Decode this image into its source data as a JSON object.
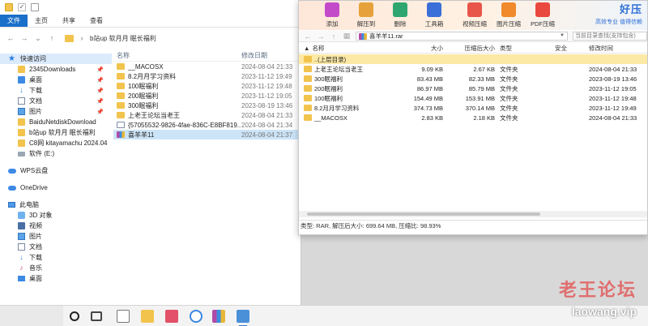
{
  "explorer": {
    "ribbon_tabs": [
      "文件",
      "主页",
      "共享",
      "查看"
    ],
    "address": "b站up 软月月 眠长福利",
    "sidebar": {
      "quick_access_label": "快速访问",
      "pinned": [
        {
          "label": "2345Downloads",
          "icon": "folder-icon"
        },
        {
          "label": "桌面",
          "icon": "desktop-icon"
        },
        {
          "label": "下载",
          "icon": "download-icon"
        },
        {
          "label": "文档",
          "icon": "document-icon"
        },
        {
          "label": "图片",
          "icon": "picture-icon"
        }
      ],
      "recent": [
        {
          "label": "BaiduNetdiskDownload",
          "icon": "folder-icon"
        },
        {
          "label": "b站up 软月月 眠长福利",
          "icon": "folder-icon"
        },
        {
          "label": "C8网 kitayamachu 2024.04",
          "icon": "folder-icon"
        },
        {
          "label": "软件 (E:)",
          "icon": "drive-icon"
        }
      ],
      "wps_label": "WPS云盘",
      "onedrive_label": "OneDrive",
      "this_pc_label": "此电脑",
      "pc_items": [
        {
          "label": "3D 对象",
          "icon": "3d-objects-icon"
        },
        {
          "label": "视频",
          "icon": "video-icon"
        },
        {
          "label": "图片",
          "icon": "picture-icon"
        },
        {
          "label": "文档",
          "icon": "document-icon"
        },
        {
          "label": "下载",
          "icon": "download-icon"
        },
        {
          "label": "音乐",
          "icon": "music-icon"
        },
        {
          "label": "桌面",
          "icon": "desktop-icon"
        }
      ]
    },
    "columns": {
      "name": "名称",
      "date": "修改日期"
    },
    "files": [
      {
        "name": "__MACOSX",
        "date": "2024-08-04 21:33",
        "kind": "folder"
      },
      {
        "name": "8.2月月学习资料",
        "date": "2023-11-12 19:49",
        "kind": "folder"
      },
      {
        "name": "100眠福利",
        "date": "2023-11-12 19:48",
        "kind": "folder"
      },
      {
        "name": "200眠福利",
        "date": "2023-11-12 19:05",
        "kind": "folder"
      },
      {
        "name": "300眠福利",
        "date": "2023-08-19 13:46",
        "kind": "folder"
      },
      {
        "name": "上老王论坛当老王",
        "date": "2024-08-04 21:33",
        "kind": "folder"
      },
      {
        "name": "{57055532-9826-4fae-836C-E8BF819...",
        "date": "2024-08-04 21:34",
        "kind": "doc"
      },
      {
        "name": "喜羊羊11",
        "date": "2024-08-04 21:37",
        "kind": "rar"
      }
    ]
  },
  "winrar": {
    "toolbar": [
      {
        "label": "添加",
        "color": "#c34bc9"
      },
      {
        "label": "解压到",
        "color": "#e6a13a"
      },
      {
        "label": "删除",
        "color": "#2fa66f"
      },
      {
        "label": "工具箱",
        "color": "#3a6ed8"
      },
      {
        "label": "视频压缩",
        "color": "#e8564a"
      },
      {
        "label": "图片压缩",
        "color": "#f08a2a"
      },
      {
        "label": "PDF压缩",
        "color": "#e8483d"
      }
    ],
    "brand": {
      "main": "好压",
      "sub": "高效专业 值得信赖"
    },
    "path": "喜羊羊11.rar",
    "search_placeholder": "当前目录查找(支持包含)",
    "columns": {
      "name": "名称",
      "size": "大小",
      "packed": "压缩后大小",
      "type": "类型",
      "security": "安全",
      "modified": "修改时间"
    },
    "rows": [
      {
        "name": "..(上层目录)",
        "size": "",
        "packed": "",
        "type": "",
        "security": "",
        "modified": ""
      },
      {
        "name": "上老王论坛当老王",
        "size": "9.09 KB",
        "packed": "2.67 KB",
        "type": "文件夹",
        "security": "",
        "modified": "2024-08-04 21:33"
      },
      {
        "name": "300眠福利",
        "size": "83.43 MB",
        "packed": "82.33 MB",
        "type": "文件夹",
        "security": "",
        "modified": "2023-08-19 13:46"
      },
      {
        "name": "200眠福利",
        "size": "86.97 MB",
        "packed": "85.79 MB",
        "type": "文件夹",
        "security": "",
        "modified": "2023-11-12 19:05"
      },
      {
        "name": "100眠福利",
        "size": "154.49 MB",
        "packed": "153.91 MB",
        "type": "文件夹",
        "security": "",
        "modified": "2023-11-12 19:48"
      },
      {
        "name": "8.2月月学习资料",
        "size": "374.73 MB",
        "packed": "370.14 MB",
        "type": "文件夹",
        "security": "",
        "modified": "2023-11-12 19:49"
      },
      {
        "name": "__MACOSX",
        "size": "2.83 KB",
        "packed": "2.18 KB",
        "type": "文件夹",
        "security": "",
        "modified": "2024-08-04 21:33"
      }
    ],
    "status": "类型: RAR, 解压后大小: 699.64 MB, 压缩比: 98.93%"
  },
  "taskbar": {
    "icons": [
      "start-icon",
      "task-view-icon",
      "file-icon",
      "explorer-icon",
      "audio-app-icon",
      "share-app-icon",
      "winrar-icon",
      "haozip-icon"
    ]
  },
  "watermark": {
    "cn": "老王论坛",
    "en": "laowang.vip"
  }
}
